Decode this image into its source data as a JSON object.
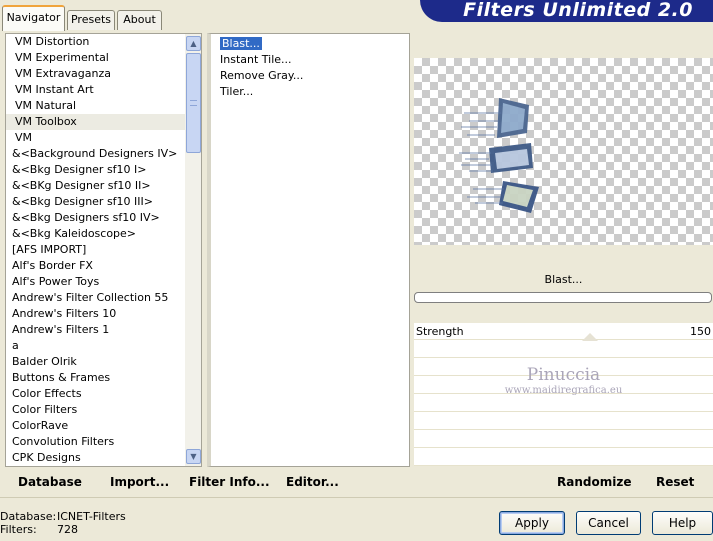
{
  "tabs": [
    {
      "label": "Navigator",
      "active": true
    },
    {
      "label": "Presets",
      "active": false
    },
    {
      "label": "About",
      "active": false
    }
  ],
  "brand": {
    "title": "Filters Unlimited 2.0",
    "color": "#1d2a8a"
  },
  "categories": [
    {
      "label": "VM Distortion"
    },
    {
      "label": "VM Experimental"
    },
    {
      "label": "VM Extravaganza"
    },
    {
      "label": "VM Instant Art"
    },
    {
      "label": "VM Natural"
    },
    {
      "label": "VM Toolbox",
      "selected": true
    },
    {
      "label": "VM"
    },
    {
      "label": "&<Background Designers IV>"
    },
    {
      "label": "&<Bkg Designer sf10 I>"
    },
    {
      "label": "&<BKg Designer sf10 II>"
    },
    {
      "label": "&<Bkg Designer sf10 III>"
    },
    {
      "label": "&<Bkg Designers sf10 IV>"
    },
    {
      "label": "&<Bkg Kaleidoscope>"
    },
    {
      "label": "[AFS IMPORT]"
    },
    {
      "label": "Alf's Border FX"
    },
    {
      "label": "Alf's Power Toys"
    },
    {
      "label": "Andrew's Filter Collection 55"
    },
    {
      "label": "Andrew's Filters 10"
    },
    {
      "label": "Andrew's Filters 1"
    },
    {
      "label": "a"
    },
    {
      "label": "Balder Olrik"
    },
    {
      "label": "Buttons & Frames"
    },
    {
      "label": "Color Effects"
    },
    {
      "label": "Color Filters"
    },
    {
      "label": "ColorRave"
    },
    {
      "label": "Convolution Filters"
    },
    {
      "label": "CPK Designs"
    }
  ],
  "filters": [
    {
      "label": "Blast...",
      "selected": true
    },
    {
      "label": "Instant Tile..."
    },
    {
      "label": "Remove Gray..."
    },
    {
      "label": "Tiler..."
    }
  ],
  "preview": {
    "filter_title": "Blast...",
    "progress": 0
  },
  "parameters": [
    {
      "label": "Strength",
      "value": "150"
    }
  ],
  "watermark": {
    "line1": "Pinuccia",
    "line2": "www.maidiregrafica.eu"
  },
  "toolbar": {
    "database": "Database",
    "import": "Import...",
    "filter_info": "Filter Info...",
    "editor": "Editor...",
    "randomize": "Randomize",
    "reset": "Reset"
  },
  "status": {
    "database_label": "Database:",
    "database_value": "ICNET-Filters",
    "filters_label": "Filters:",
    "filters_value": "728"
  },
  "buttons": {
    "apply": "Apply",
    "cancel": "Cancel",
    "help": "Help"
  },
  "icons": {
    "scroll_up": "chevron-up-icon",
    "scroll_down": "chevron-down-icon"
  }
}
